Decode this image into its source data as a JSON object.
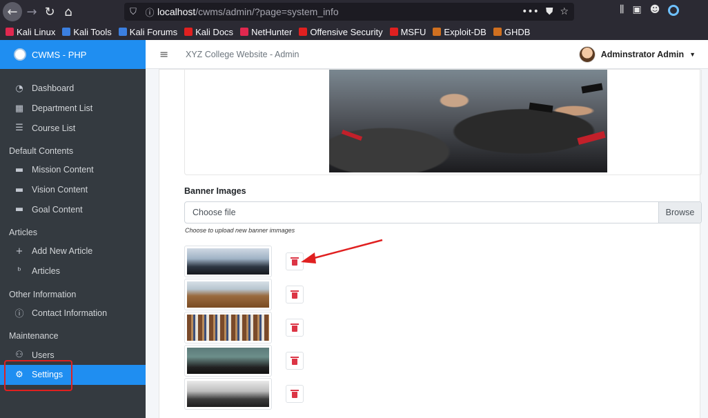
{
  "browser": {
    "url_host": "localhost",
    "url_path": "/cwms/admin/?page=system_info",
    "bookmarks": [
      {
        "label": "Kali Linux",
        "color": "#e0284f"
      },
      {
        "label": "Kali Tools",
        "color": "#3b7fe0"
      },
      {
        "label": "Kali Forums",
        "color": "#3b7fe0"
      },
      {
        "label": "Kali Docs",
        "color": "#e02020"
      },
      {
        "label": "NetHunter",
        "color": "#e0284f"
      },
      {
        "label": "Offensive Security",
        "color": "#e02020"
      },
      {
        "label": "MSFU",
        "color": "#e02020"
      },
      {
        "label": "Exploit-DB",
        "color": "#d07020"
      },
      {
        "label": "GHDB",
        "color": "#d07020"
      }
    ]
  },
  "sidebar": {
    "brand": "CWMS - PHP",
    "items": [
      {
        "type": "item",
        "label": "Dashboard",
        "icon": "dashboard-icon",
        "glyph": "◔"
      },
      {
        "type": "item",
        "label": "Department List",
        "icon": "building-icon",
        "glyph": "▦"
      },
      {
        "type": "item",
        "label": "Course List",
        "icon": "list-icon",
        "glyph": "☰"
      },
      {
        "type": "header",
        "label": "Default Contents"
      },
      {
        "type": "item",
        "label": "Mission Content",
        "icon": "window-icon",
        "glyph": "▬"
      },
      {
        "type": "item",
        "label": "Vision Content",
        "icon": "window-icon",
        "glyph": "▬"
      },
      {
        "type": "item",
        "label": "Goal Content",
        "icon": "window-icon",
        "glyph": "▬"
      },
      {
        "type": "header",
        "label": "Articles"
      },
      {
        "type": "item",
        "label": "Add New Article",
        "icon": "plus-icon",
        "glyph": "+"
      },
      {
        "type": "item",
        "label": "Articles",
        "icon": "blog-icon",
        "glyph": "ᵇ"
      },
      {
        "type": "header",
        "label": "Other Information"
      },
      {
        "type": "item",
        "label": "Contact Information",
        "icon": "info-icon",
        "glyph": "ⓘ"
      },
      {
        "type": "header",
        "label": "Maintenance"
      },
      {
        "type": "item",
        "label": "Users",
        "icon": "users-icon",
        "glyph": "⚇"
      },
      {
        "type": "item",
        "label": "Settings",
        "icon": "cogs-icon",
        "glyph": "⚙",
        "active": true
      }
    ]
  },
  "topnav": {
    "site_title": "XYZ College Website - Admin",
    "user_name": "Adminstrator Admin"
  },
  "content": {
    "banner_label": "Banner Images",
    "file_placeholder": "Choose file",
    "browse_label": "Browse",
    "hint": "Choose to upload new banner immages",
    "banner_images": [
      {
        "name": "banner-graduation-caps"
      },
      {
        "name": "banner-lecture-hall"
      },
      {
        "name": "banner-library"
      },
      {
        "name": "banner-graduates-crowd"
      },
      {
        "name": "banner-classroom"
      }
    ]
  },
  "colors": {
    "accent": "#1f8ef1",
    "sidebar_bg": "#343a40",
    "danger": "#dc3545",
    "annotation_red": "#e02020"
  }
}
